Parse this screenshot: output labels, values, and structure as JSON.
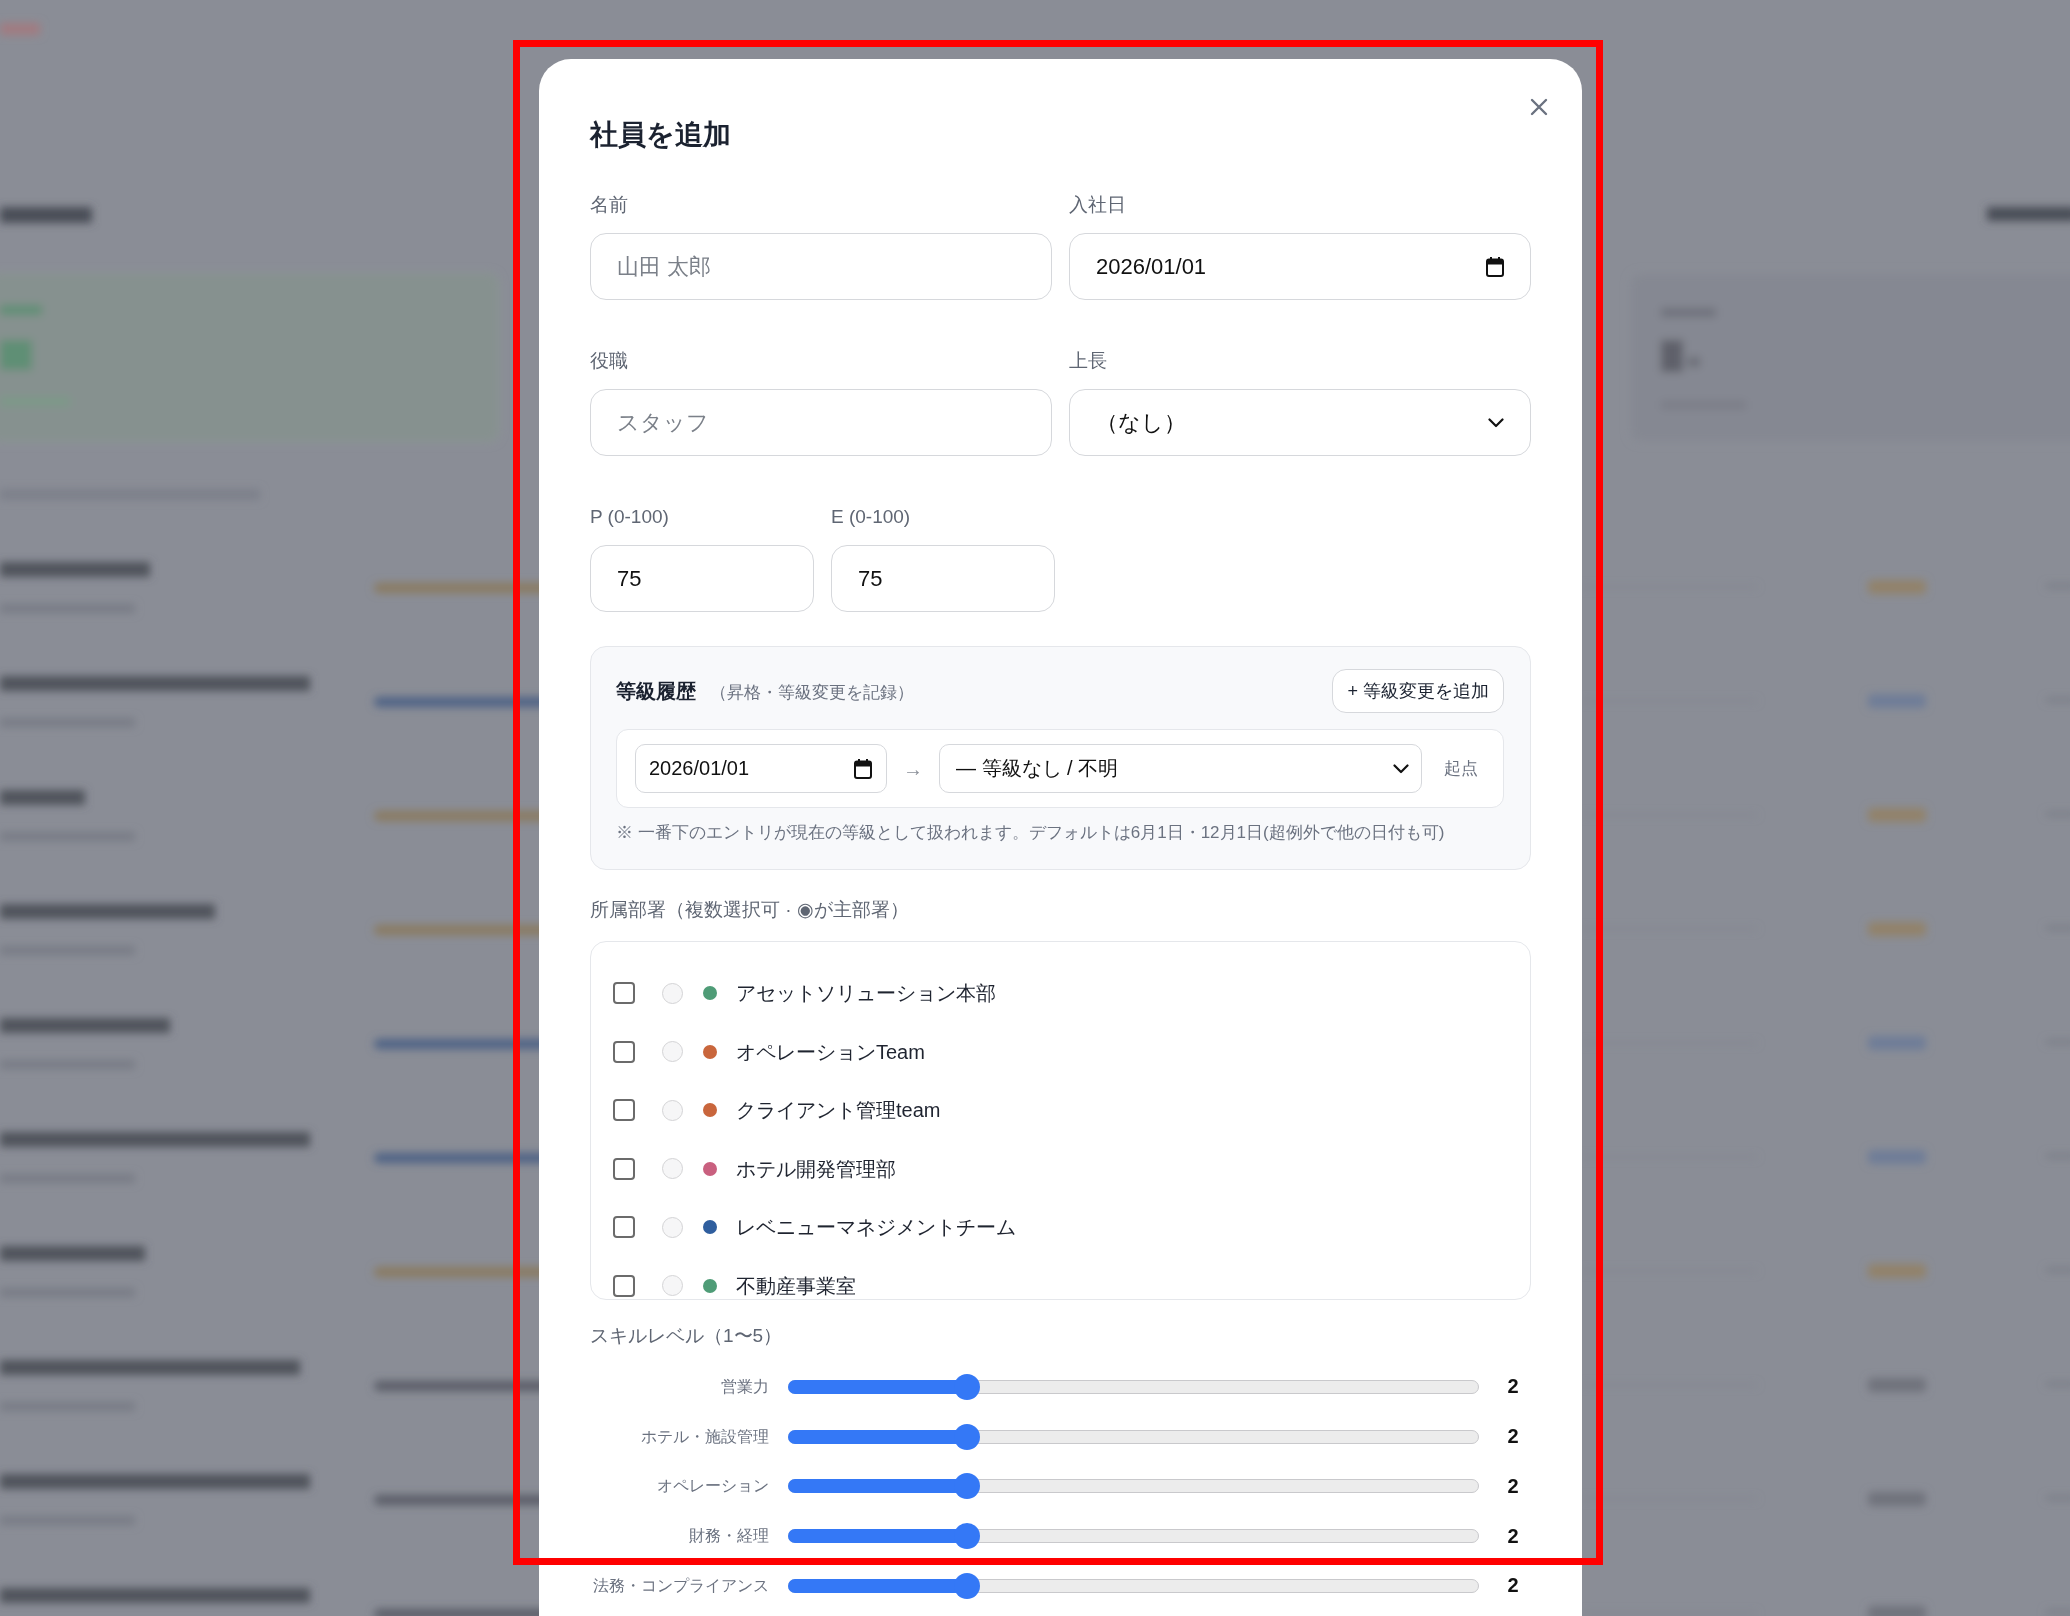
{
  "dialog": {
    "title": "社員を追加"
  },
  "form_rows": [
    [
      {
        "kind": "text",
        "label": "名前",
        "placeholder": "山田 太郎"
      },
      {
        "kind": "date",
        "label": "入社日",
        "value": "2026/01/01"
      }
    ],
    [
      {
        "kind": "text",
        "label": "役職",
        "placeholder": "スタッフ"
      },
      {
        "kind": "select",
        "label": "上長",
        "value": "（なし）"
      }
    ],
    [
      {
        "kind": "number",
        "label": "P (0-100)",
        "value": "75"
      },
      {
        "kind": "number",
        "label": "E (0-100)",
        "value": "75"
      }
    ]
  ],
  "grade_history": {
    "title": "等級履歴",
    "subtitle": "（昇格・等級変更を記録）",
    "add_button": "+ 等級変更を追加",
    "entries": [
      {
        "date": "2026/01/01",
        "arrow": "→",
        "grade": "— 等級なし / 不明",
        "tag": "起点"
      }
    ],
    "note": "※ 一番下のエントリが現在の等級として扱われます。デフォルトは6月1日・12月1日(超例外で他の日付も可)"
  },
  "departments": {
    "label": "所属部署（複数選択可 · ◉が主部署）",
    "items": [
      {
        "name": "アセットソリューション本部",
        "checked": false,
        "selected": false,
        "color": "#4f9c77"
      },
      {
        "name": "オペレーションTeam",
        "checked": false,
        "selected": false,
        "color": "#c9663c"
      },
      {
        "name": "クライアント管理team",
        "checked": false,
        "selected": false,
        "color": "#c9663c"
      },
      {
        "name": "ホテル開発管理部",
        "checked": false,
        "selected": false,
        "color": "#c9607f"
      },
      {
        "name": "レベニューマネジメントチーム",
        "checked": false,
        "selected": false,
        "color": "#2f5e9e"
      },
      {
        "name": "不動産事業室",
        "checked": false,
        "selected": false,
        "color": "#4f9c77"
      }
    ]
  },
  "skills": {
    "label": "スキルレベル（1〜5）",
    "items": [
      {
        "name": "営業力",
        "level": 0.25,
        "reading": "2"
      },
      {
        "name": "ホテル・施設管理",
        "level": 0.25,
        "reading": "2"
      },
      {
        "name": "オペレーション",
        "level": 0.25,
        "reading": "2"
      },
      {
        "name": "財務・経理",
        "level": 0.25,
        "reading": "2"
      },
      {
        "name": "法務・コンプライアンス",
        "level": 0.25,
        "reading": "2"
      }
    ]
  },
  "annotation": {
    "kind": "frame"
  }
}
